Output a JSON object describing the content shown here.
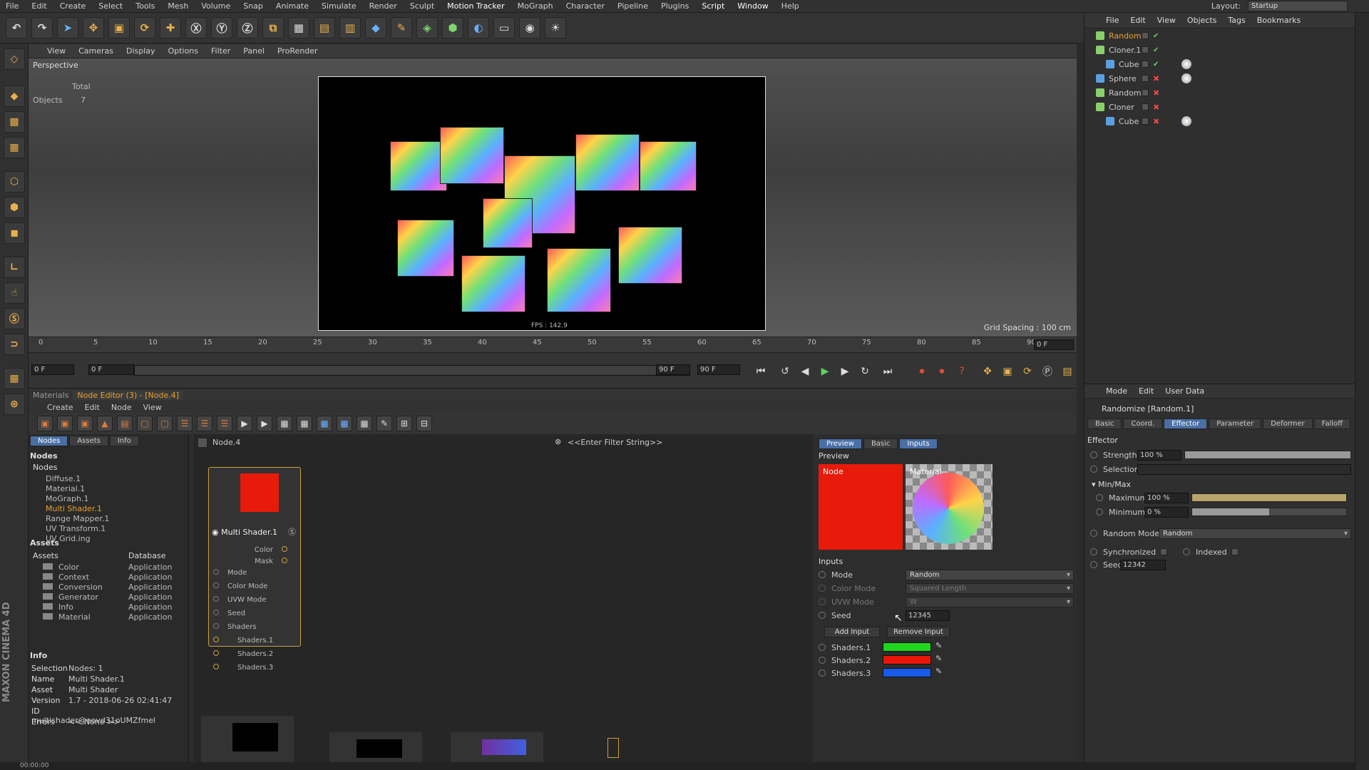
{
  "menubar": [
    "File",
    "Edit",
    "Create",
    "Select",
    "Tools",
    "Mesh",
    "Volume",
    "Snap",
    "Animate",
    "Simulate",
    "Render",
    "Sculpt",
    "Motion Tracker",
    "MoGraph",
    "Character",
    "Pipeline",
    "Plugins",
    "Script",
    "Window",
    "Help"
  ],
  "layout": {
    "label": "Layout:",
    "value": "Startup"
  },
  "viewport": {
    "menu": [
      "View",
      "Cameras",
      "Display",
      "Options",
      "Filter",
      "Panel",
      "ProRender"
    ],
    "label": "Perspective",
    "hud_total": "Total",
    "hud_objects_label": "Objects",
    "hud_objects_value": "7",
    "grid_spacing": "Grid Spacing : 100 cm",
    "fps": "FPS : 142.9"
  },
  "timeline": {
    "ticks": [
      "0",
      "5",
      "10",
      "15",
      "20",
      "25",
      "30",
      "35",
      "40",
      "45",
      "50",
      "55",
      "60",
      "65",
      "70",
      "75",
      "80",
      "85",
      "90"
    ],
    "current_frame": "0 F",
    "start": "0 F",
    "range_start": "0 F",
    "range_end": "90 F",
    "end": "90 F"
  },
  "object_manager": {
    "menu": [
      "File",
      "Edit",
      "View",
      "Objects",
      "Tags",
      "Bookmarks"
    ],
    "items": [
      {
        "name": "Random",
        "indent": 0,
        "active": true
      },
      {
        "name": "Cloner.1",
        "indent": 0
      },
      {
        "name": "Cube",
        "indent": 1
      },
      {
        "name": "Sphere",
        "indent": 0
      },
      {
        "name": "Random",
        "indent": 0
      },
      {
        "name": "Cloner",
        "indent": 0
      },
      {
        "name": "Cube",
        "indent": 1
      }
    ]
  },
  "attributes": {
    "menu": [
      "Mode",
      "Edit",
      "User Data"
    ],
    "title": "Randomize [Random.1]",
    "tabs": [
      "Basic",
      "Coord.",
      "Effector",
      "Parameter",
      "Deformer",
      "Falloff"
    ],
    "active_tab": "Effector",
    "section": "Effector",
    "strength_label": "Strength",
    "strength_value": "100 %",
    "strength_fraction": 1.0,
    "selection_label": "Selection",
    "minmax_label": "Min/Max",
    "maximum_label": "Maximum",
    "maximum_value": "100 %",
    "maximum_fraction": 1.0,
    "minimum_label": "Minimum",
    "minimum_value": "0 %",
    "minimum_fraction": 0.5,
    "random_mode_label": "Random Mode",
    "random_mode_value": "Random",
    "synchronized_label": "Synchronized",
    "indexed_label": "Indexed",
    "seed_label": "Seed",
    "seed_value": "12342"
  },
  "lower": {
    "tabs": [
      "Materials",
      "Node Editor (3) - [Node.4]"
    ],
    "menu": [
      "Create",
      "Edit",
      "Node",
      "View"
    ],
    "left_tabs": [
      "Nodes",
      "Assets",
      "Info"
    ],
    "nodes_header": "Nodes",
    "nodes_col": "Nodes",
    "nodes": [
      "Diffuse.1",
      "Material.1",
      "MoGraph.1",
      "Multi Shader.1",
      "Range Mapper.1",
      "UV Transform.1",
      "UV Grid.ing"
    ],
    "assets_header": "Assets",
    "assets_col": "Assets",
    "database_col": "Database",
    "assets": [
      {
        "name": "Color",
        "db": "Application"
      },
      {
        "name": "Context",
        "db": "Application"
      },
      {
        "name": "Conversion",
        "db": "Application"
      },
      {
        "name": "Generator",
        "db": "Application"
      },
      {
        "name": "Info",
        "db": "Application"
      },
      {
        "name": "Material",
        "db": "Application"
      }
    ],
    "info_header": "Info",
    "info": [
      {
        "k": "Selection",
        "v": "Nodes: 1"
      },
      {
        "k": "Name",
        "v": "Multi Shader.1"
      },
      {
        "k": "Asset",
        "v": "Multi Shader"
      },
      {
        "k": "Version",
        "v": "1.7 - 2018-06-26 02:41:47"
      },
      {
        "k": "ID",
        "v": "multishader@eovd31oUMZfmel"
      },
      {
        "k": "Errors",
        "v": "<< None >>"
      }
    ],
    "breadcrumb": "Node.4",
    "filter_placeholder": "<<Enter Filter String>>",
    "node": {
      "title": "Multi Shader.1",
      "outputs": [
        "Color",
        "Mask"
      ],
      "inputs": [
        "Mode",
        "Color Mode",
        "UVW Mode",
        "Seed",
        "Shaders",
        "Shaders.1",
        "Shaders.2",
        "Shaders.3"
      ]
    },
    "right_tabs": [
      "Preview",
      "Basic",
      "Inputs"
    ],
    "preview_label": "Preview",
    "preview_node": "Node",
    "preview_material": "Material",
    "inputs_label": "Inputs",
    "mode_label": "Mode",
    "mode_value": "Random",
    "color_mode_label": "Color Mode",
    "color_mode_value": "Squared Length",
    "uvw_mode_label": "UVW Mode",
    "uvw_mode_value": "W",
    "seed_label": "Seed",
    "seed_value": "12345",
    "add_input": "Add Input",
    "remove_input": "Remove Input",
    "shaders": [
      {
        "name": "Shaders.1",
        "color": "#1ed61e"
      },
      {
        "name": "Shaders.2",
        "color": "#e8160a"
      },
      {
        "name": "Shaders.3",
        "color": "#1a5ae8"
      }
    ]
  },
  "status": "00:00:00",
  "brand": "MAXON CINEMA 4D"
}
